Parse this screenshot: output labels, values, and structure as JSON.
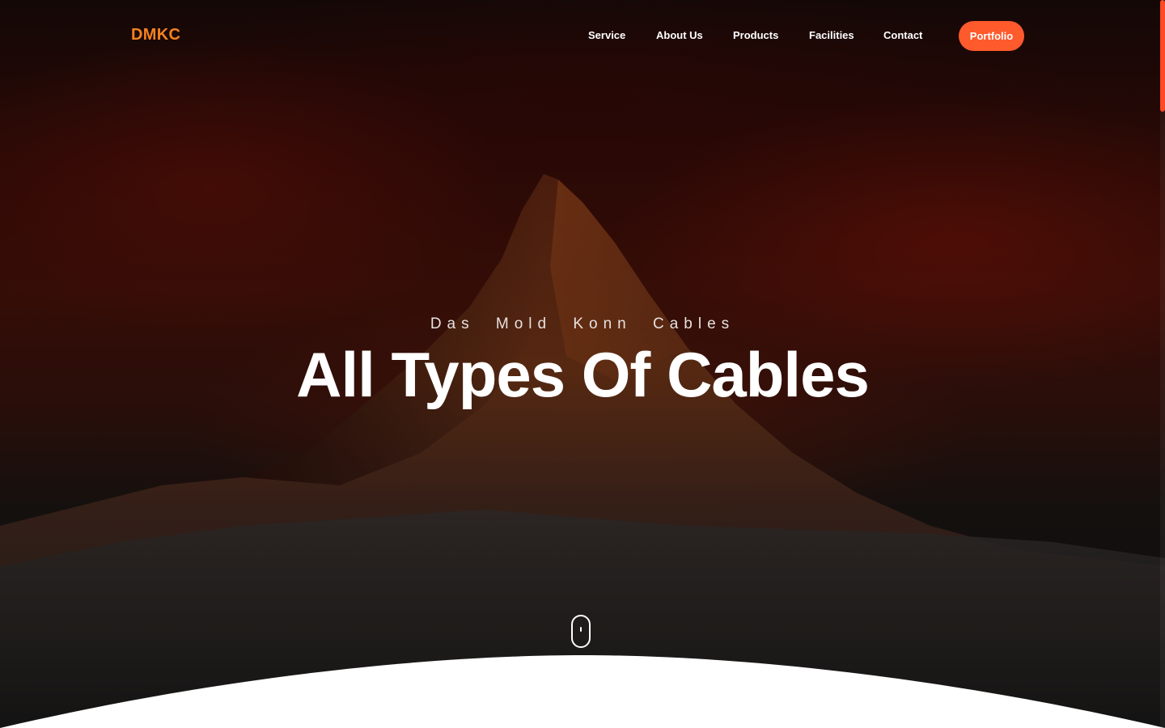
{
  "brand": {
    "logo_text": "DMKC",
    "logo_color": "#f5821f"
  },
  "nav": {
    "items": [
      {
        "label": "Service"
      },
      {
        "label": "About Us"
      },
      {
        "label": "Products"
      },
      {
        "label": "Facilities"
      },
      {
        "label": "Contact"
      }
    ],
    "cta_label": "Portfolio",
    "cta_color": "#ff5a2c"
  },
  "hero": {
    "subtitle": "Das Mold Konn Cables",
    "headline": "All Types Of Cables",
    "background_description_icon": "mountain-peak-image"
  },
  "scroll_indicator": {
    "icon": "mouse-scroll-icon"
  },
  "colors": {
    "accent": "#ff5a2c",
    "scrollbar_thumb": "#ff4a24"
  }
}
